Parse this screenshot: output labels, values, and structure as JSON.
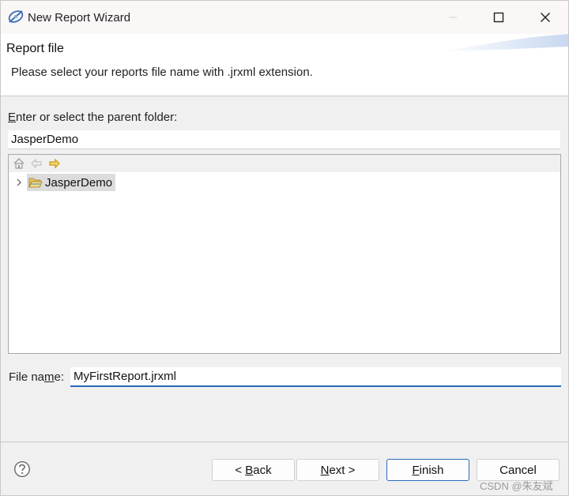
{
  "window": {
    "title": "New Report Wizard",
    "controls": {
      "minimize": "minimize",
      "maximize": "maximize",
      "close": "close"
    }
  },
  "header": {
    "title": "Report file",
    "description": "Please select your reports file name with .jrxml extension."
  },
  "folder": {
    "label_mnemonic": "E",
    "label_rest": "nter or select the parent folder:",
    "value": "JasperDemo"
  },
  "tree": {
    "toolbar_icons": [
      "home-icon",
      "back-arrow-icon",
      "forward-arrow-icon"
    ],
    "items": [
      {
        "label": "JasperDemo",
        "icon": "open-folder-icon",
        "selected": true
      }
    ]
  },
  "file": {
    "label_before": "File na",
    "label_mnemonic": "m",
    "label_after": "e:",
    "value": "MyFirstReport.jrxml"
  },
  "buttons": {
    "back_prefix": "< ",
    "back_mnemonic": "B",
    "back_rest": "ack",
    "next_mnemonic": "N",
    "next_rest": "ext >",
    "finish_mnemonic": "F",
    "finish_rest": "inish",
    "cancel": "Cancel"
  },
  "watermark": "CSDN @朱友斌",
  "colors": {
    "accent": "#2a6ab8",
    "selection": "#dcdcdc",
    "dialog_bg": "#f0f0f0"
  }
}
